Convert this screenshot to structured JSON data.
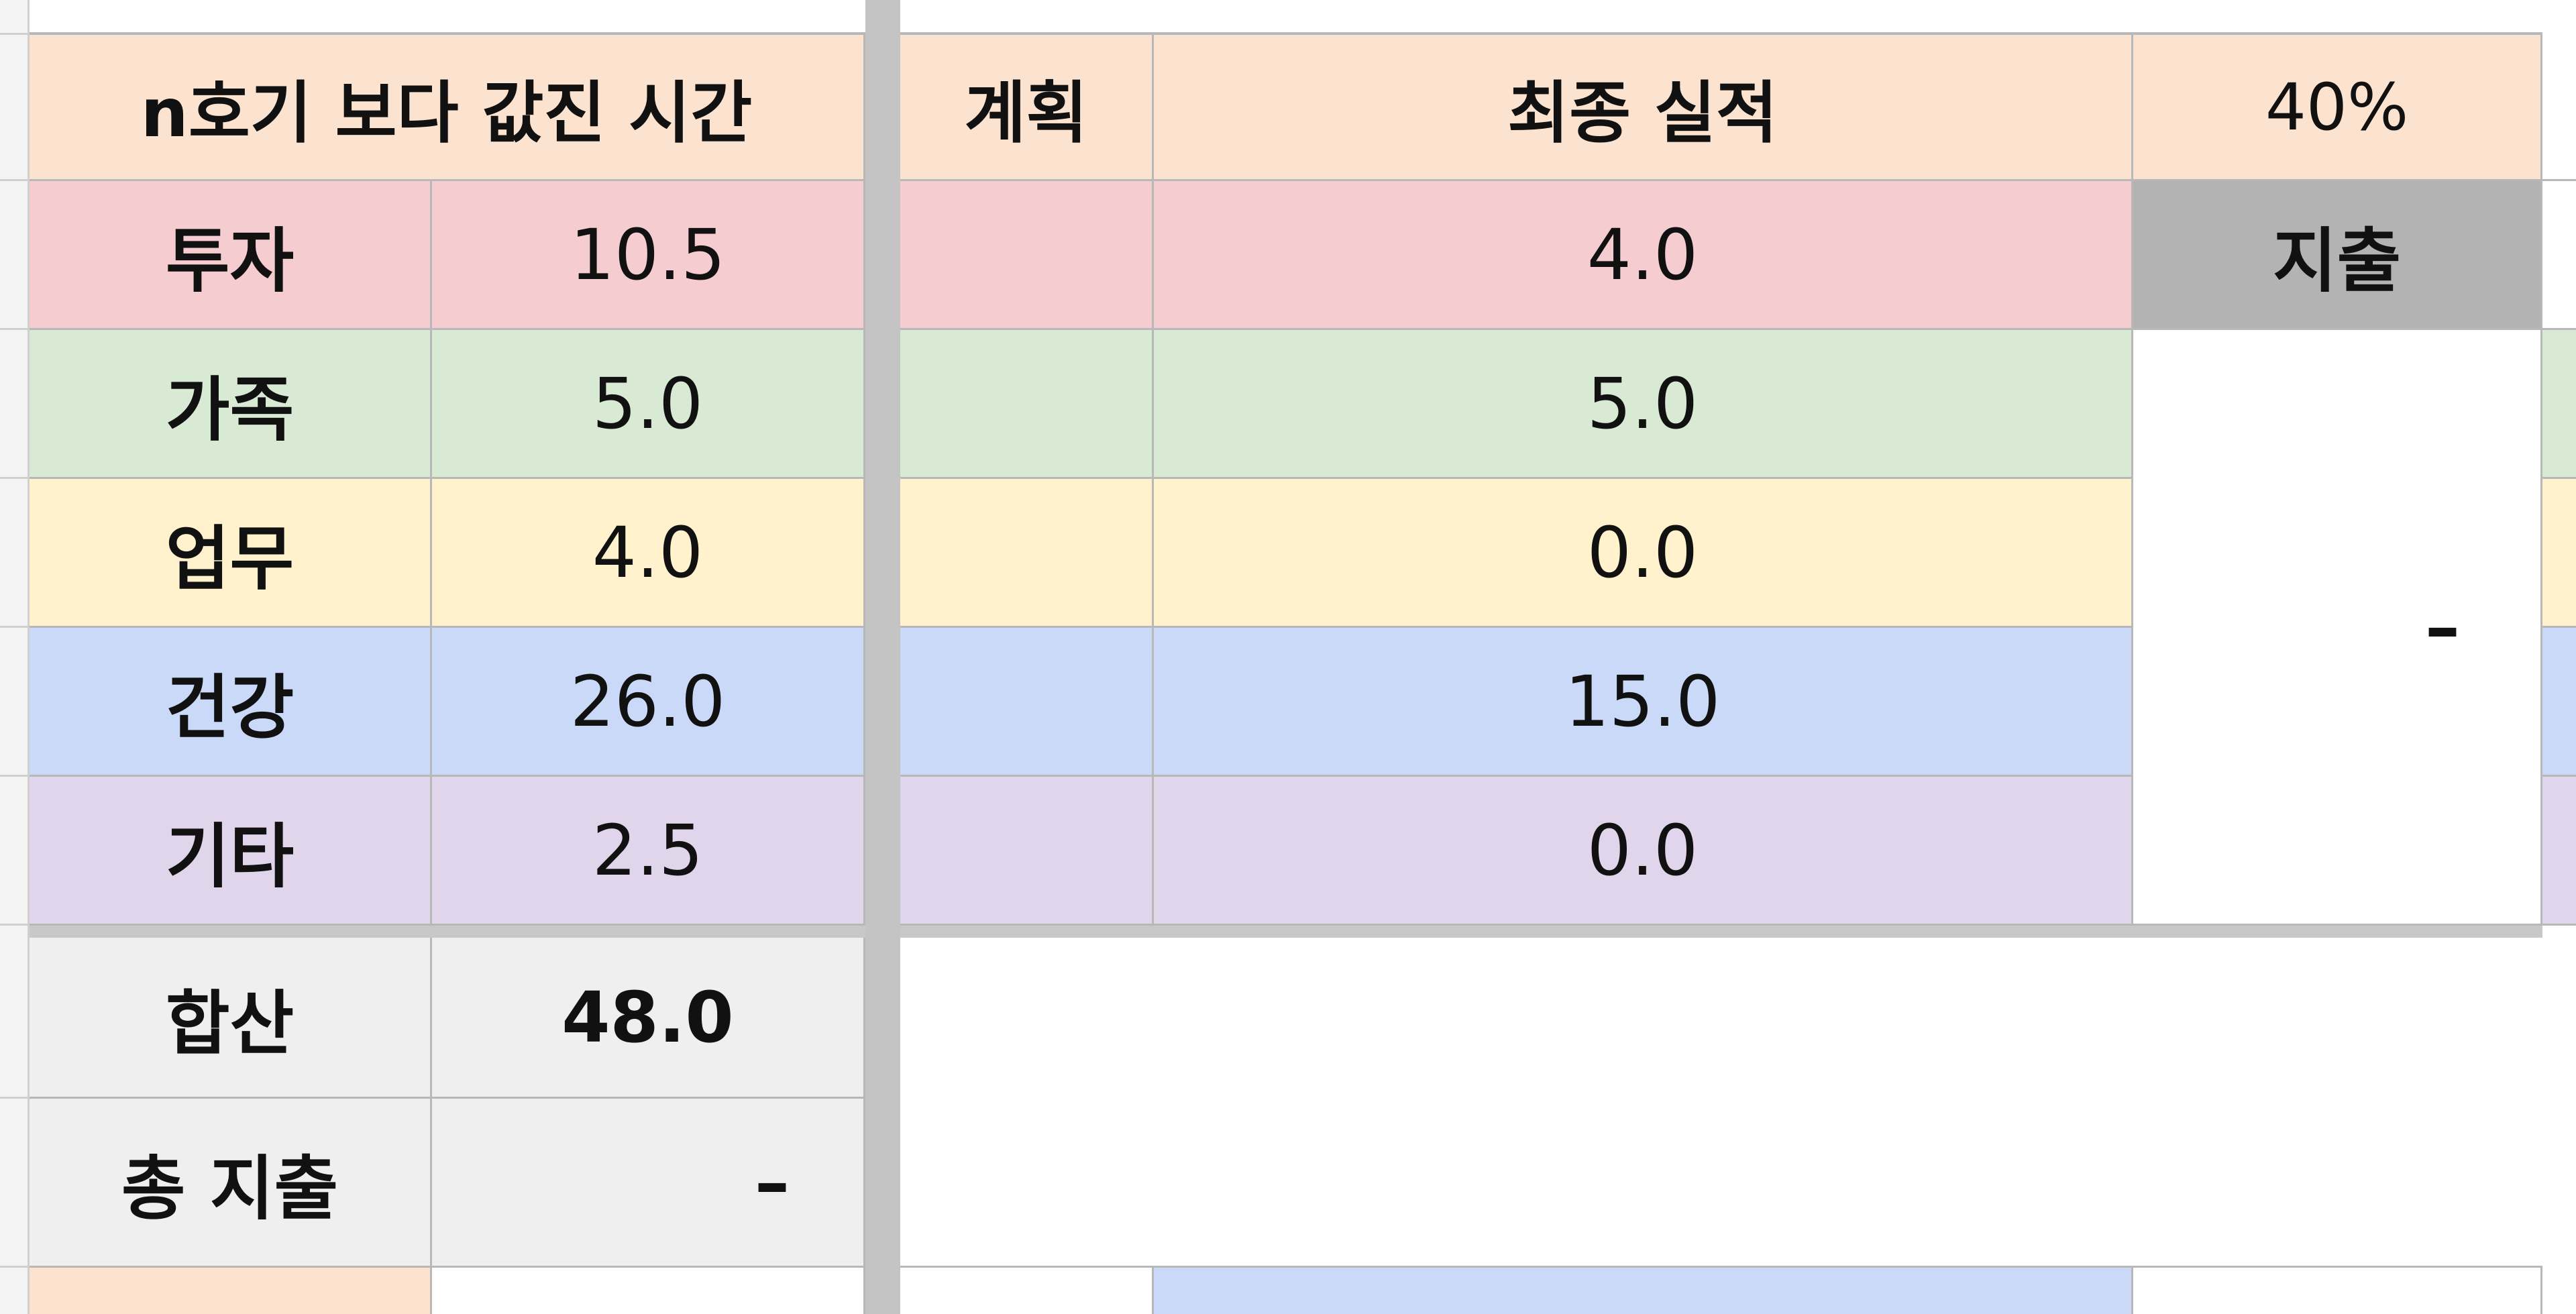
{
  "left_table": {
    "header": "n호기 보다 값진 시간",
    "rows": [
      {
        "label": "투자",
        "value": "10.5",
        "color": "#f5cdd0"
      },
      {
        "label": "가족",
        "value": "5.0",
        "color": "#d9ead4"
      },
      {
        "label": "업무",
        "value": "4.0",
        "color": "#fff2cc"
      },
      {
        "label": "건강",
        "value": "26.0",
        "color": "#c9d9f7"
      },
      {
        "label": "기타",
        "value": "2.5",
        "color": "#e1d5ec"
      }
    ],
    "total_label": "합산",
    "total_value": "48.0",
    "spend_label": "총 지출",
    "spend_value": "–"
  },
  "right_table": {
    "header_plan": "계획",
    "header_actual": "최종 실적",
    "header_percent": "40%",
    "actuals": [
      "4.0",
      "5.0",
      "0.0",
      "15.0",
      "0.0"
    ],
    "expense_label": "지출",
    "expense_value": "–"
  }
}
